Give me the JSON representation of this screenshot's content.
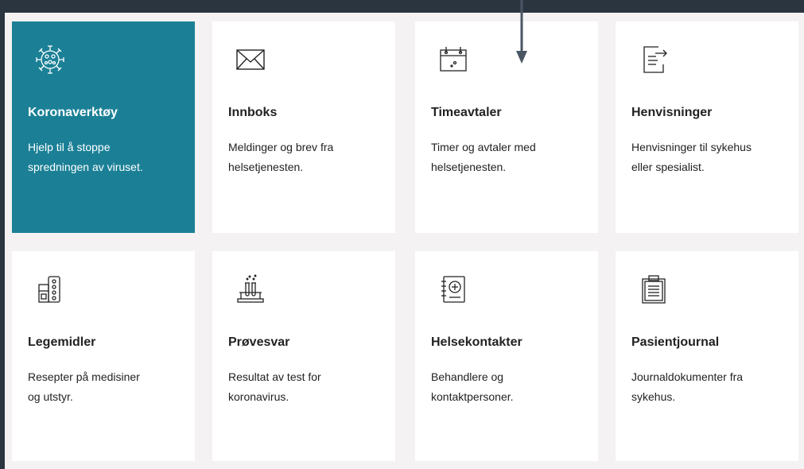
{
  "tiles": [
    {
      "key": "korona",
      "title": "Koronaverktøy",
      "desc_line1": "Hjelp til å stoppe",
      "desc_line2": "spredningen av viruset.",
      "icon": "virus-icon"
    },
    {
      "key": "innboks",
      "title": "Innboks",
      "desc_line1": "Meldinger og brev fra",
      "desc_line2": "helsetjenesten.",
      "icon": "envelope-icon"
    },
    {
      "key": "timeavtaler",
      "title": "Timeavtaler",
      "desc_line1": "Timer og avtaler med",
      "desc_line2": "helsetjenesten.",
      "icon": "calendar-icon"
    },
    {
      "key": "henvisninger",
      "title": "Henvisninger",
      "desc_line1": "Henvisninger til sykehus",
      "desc_line2": "eller spesialist.",
      "icon": "referral-document-icon"
    },
    {
      "key": "legemidler",
      "title": "Legemidler",
      "desc_line1": "Resepter på medisiner",
      "desc_line2": "og utstyr.",
      "icon": "medicine-icon"
    },
    {
      "key": "provesvar",
      "title": "Prøvesvar",
      "desc_line1": "Resultat av test for",
      "desc_line2": "koronavirus.",
      "icon": "test-tubes-icon"
    },
    {
      "key": "helsekontakter",
      "title": "Helsekontakter",
      "desc_line1": "Behandlere og",
      "desc_line2": "kontaktpersoner.",
      "icon": "contact-book-icon"
    },
    {
      "key": "pasientjournal",
      "title": "Pasientjournal",
      "desc_line1": "Journaldokumenter fra",
      "desc_line2": "sykehus.",
      "icon": "clipboard-icon"
    }
  ],
  "colors": {
    "frame": "#2a3540",
    "panel": "#f4f2f2",
    "featured": "#1b8096",
    "tile": "#ffffff",
    "text": "#222222"
  }
}
